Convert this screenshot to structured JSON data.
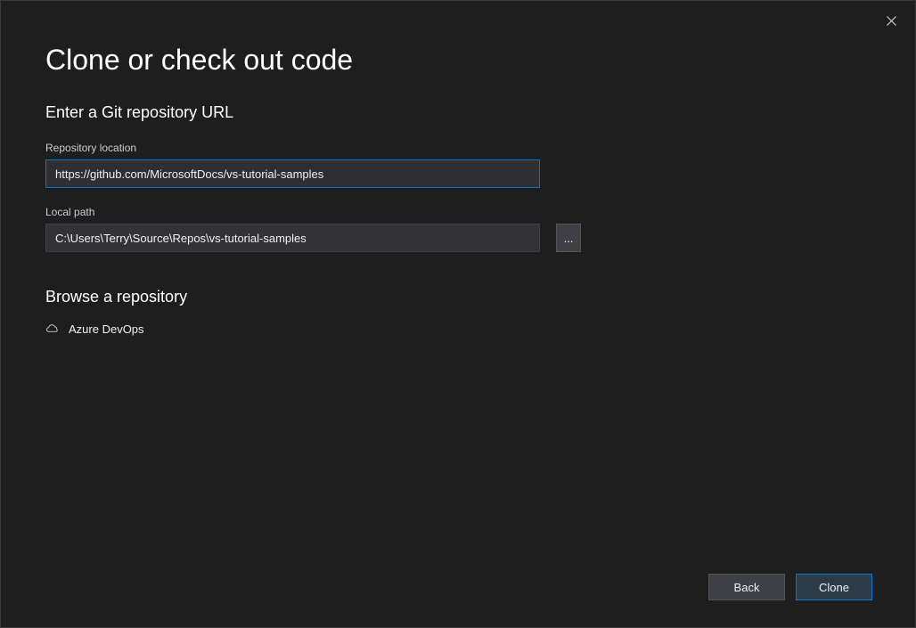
{
  "header": {
    "title": "Clone or check out code"
  },
  "section_url": {
    "subtitle": "Enter a Git repository URL",
    "repo_label": "Repository location",
    "repo_value": "https://github.com/MicrosoftDocs/vs-tutorial-samples",
    "path_label": "Local path",
    "path_value": "C:\\Users\\Terry\\Source\\Repos\\vs-tutorial-samples",
    "browse_label": "..."
  },
  "section_browse": {
    "title": "Browse a repository",
    "items": [
      {
        "label": "Azure DevOps",
        "icon": "cloud-icon"
      }
    ]
  },
  "footer": {
    "back_label": "Back",
    "clone_label": "Clone"
  }
}
